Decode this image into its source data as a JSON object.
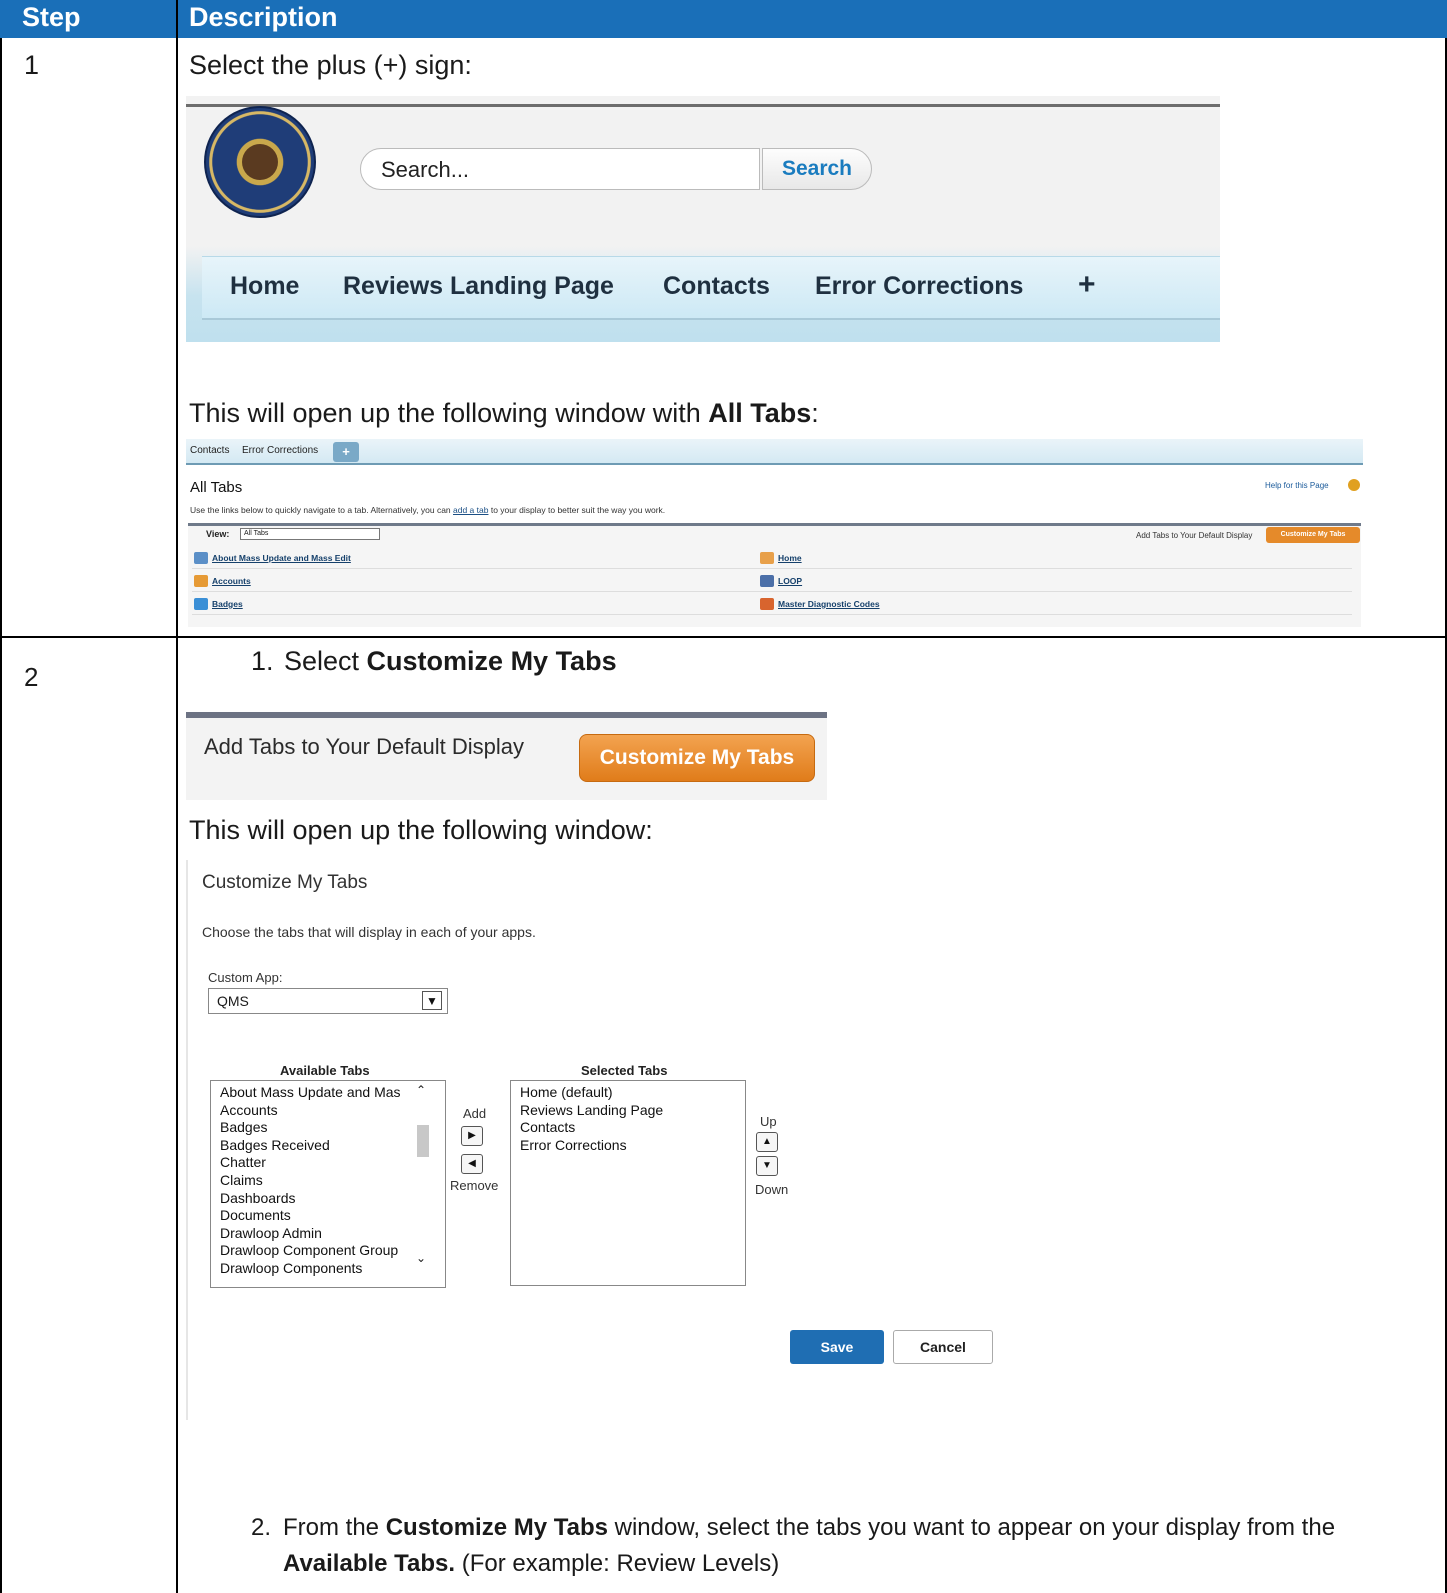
{
  "table": {
    "header_step": "Step",
    "header_description": "Description"
  },
  "step1": {
    "number": "1",
    "intro": "Select the plus (+) sign:",
    "shot_search": {
      "search_placeholder": "Search...",
      "search_button": "Search",
      "nav_items": [
        "Home",
        "Reviews Landing Page",
        "Contacts",
        "Error Corrections"
      ],
      "plus_glyph": "+"
    },
    "open_text_prefix": "This will open up the following window with ",
    "open_text_bold": "All Tabs",
    "open_text_suffix": ":",
    "shot_all_tabs": {
      "tabs": [
        "Contacts",
        "Error Corrections"
      ],
      "plus_glyph": "+",
      "title": "All Tabs",
      "help_link": "Help for this Page",
      "desc_before": "Use the links below to quickly navigate to a tab. Alternatively, you can ",
      "desc_link": "add a tab",
      "desc_after": " to your display to better suit the way you work.",
      "view_label": "View:",
      "view_value": "All Tabs",
      "add_tabs_label": "Add Tabs to Your Default Display",
      "customize_button": "Customize My Tabs",
      "left_links": [
        "About Mass Update and Mass Edit",
        "Accounts",
        "Badges"
      ],
      "right_links": [
        "Home",
        "LOOP",
        "Master Diagnostic Codes"
      ]
    }
  },
  "step2": {
    "number": "2",
    "item1_num": "1.",
    "item1_prefix": "Select ",
    "item1_bold": "Customize My Tabs",
    "shot_customize_btn": {
      "label": "Add Tabs to Your Default Display",
      "button": "Customize My Tabs"
    },
    "open_text": "This will open up the following window:",
    "shot_customize": {
      "title": "Customize My Tabs",
      "description": "Choose the tabs that will display in each of your apps.",
      "custom_app_label": "Custom App:",
      "custom_app_value": "QMS",
      "available_label": "Available Tabs",
      "selected_label": "Selected Tabs",
      "available_tabs": [
        "About Mass Update and Mas",
        "Accounts",
        "Badges",
        "Badges Received",
        "Chatter",
        "Claims",
        "Dashboards",
        "Documents",
        "Drawloop Admin",
        "Drawloop Component Group",
        "Drawloop Components"
      ],
      "selected_tabs": [
        "Home (default)",
        "Reviews Landing Page",
        "Contacts",
        "Error Corrections"
      ],
      "add_label": "Add",
      "remove_label": "Remove",
      "up_label": "Up",
      "down_label": "Down",
      "save_button": "Save",
      "cancel_button": "Cancel"
    },
    "item2_num": "2.",
    "item2_text1": "From the ",
    "item2_bold1": "Customize My Tabs",
    "item2_text2": " window, select the tabs you want to appear on your display from the ",
    "item2_bold2": "Available Tabs.",
    "item2_text3": " (For example: Review Levels)"
  },
  "colors": {
    "header_blue": "#1a6fb8",
    "orange_button": "#e58a2a",
    "save_blue": "#1f6eb3"
  }
}
